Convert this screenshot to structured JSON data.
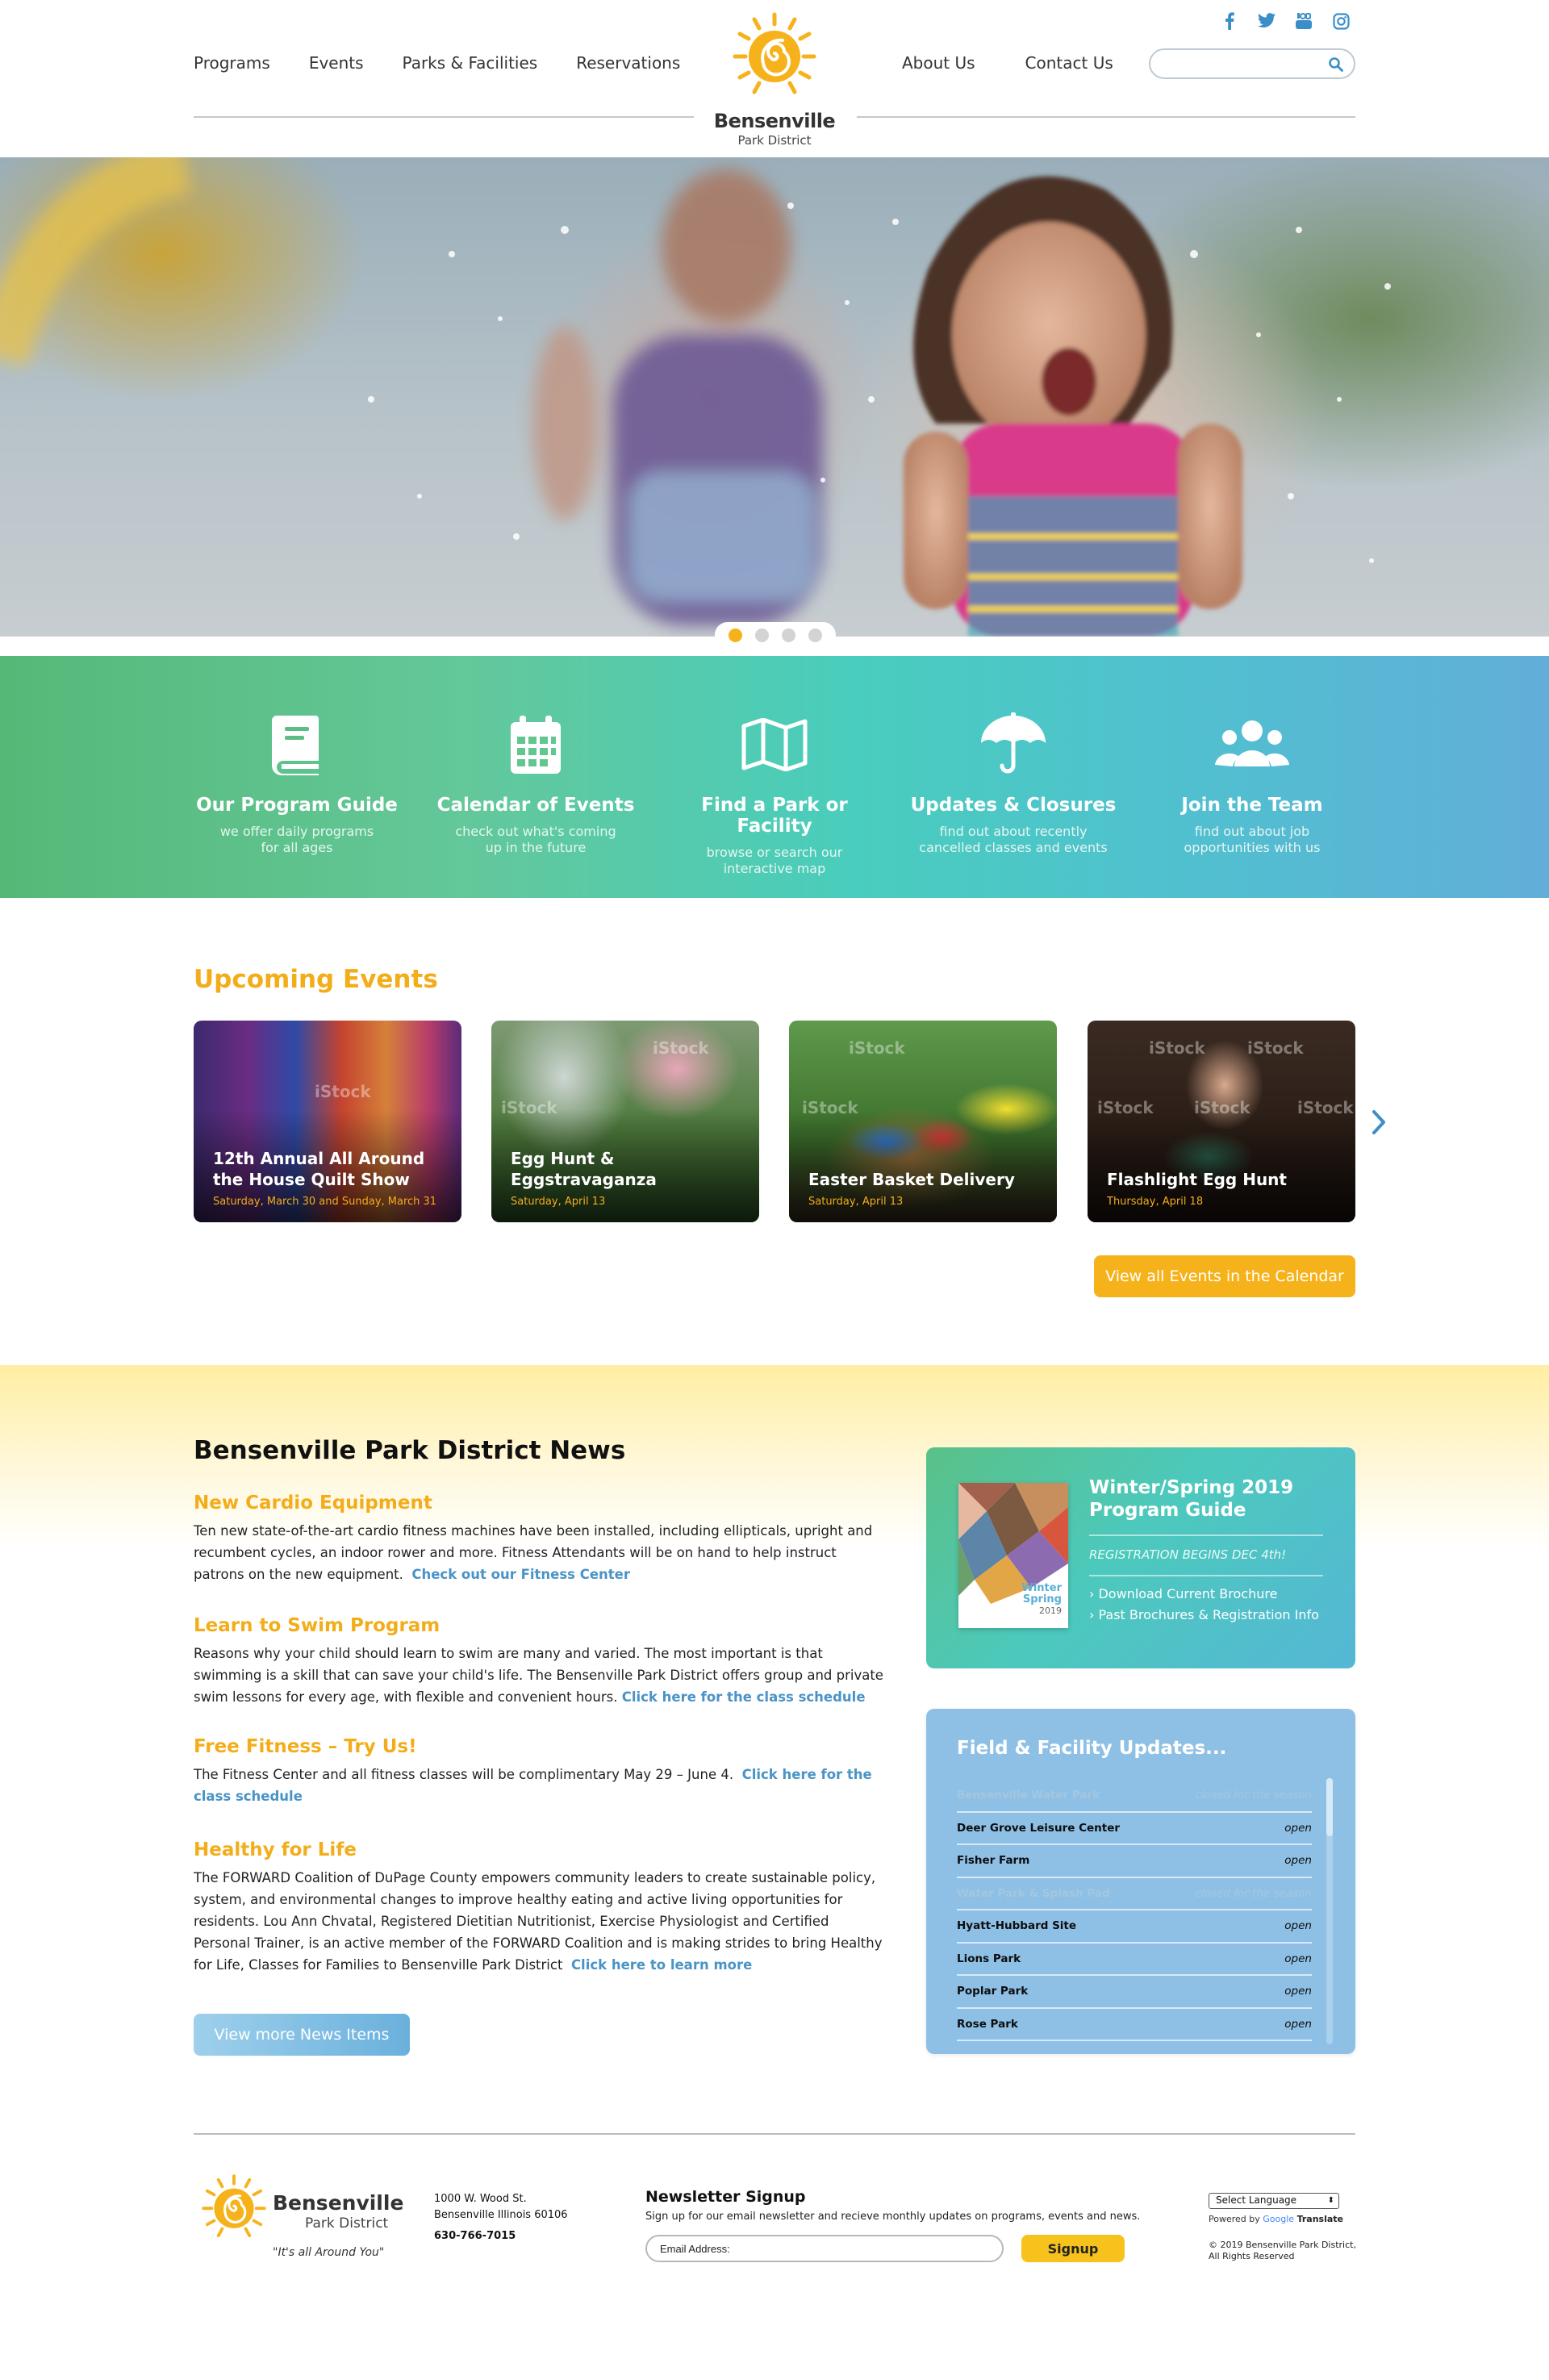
{
  "header": {
    "nav_left": [
      "Programs",
      "Events",
      "Parks & Facilities",
      "Reservations"
    ],
    "nav_right": [
      "About Us",
      "Contact Us"
    ],
    "logo": {
      "name": "Bensenville",
      "sub": "Park District"
    },
    "social": [
      "facebook-icon",
      "twitter-icon",
      "youtube-icon",
      "instagram-icon"
    ],
    "search": {
      "placeholder": "",
      "value": ""
    }
  },
  "hero": {
    "slides": 4,
    "active_slide": 1
  },
  "colors": {
    "accent_yellow": "#f6b21b",
    "link_blue": "#4a93c6",
    "band_start": "#56b877",
    "band_end": "#62aed8"
  },
  "quick_links": [
    {
      "icon": "book-icon",
      "title": "Our Program Guide",
      "desc1": "we offer daily programs",
      "desc2": "for all ages"
    },
    {
      "icon": "calendar-icon",
      "title": "Calendar of Events",
      "desc1": "check out what's coming",
      "desc2": "up in the future"
    },
    {
      "icon": "map-icon",
      "title": "Find a Park or Facility",
      "desc1": "browse or search our",
      "desc2": "interactive map"
    },
    {
      "icon": "umbrella-icon",
      "title": "Updates & Closures",
      "desc1": "find out about recently",
      "desc2": "cancelled classes and events"
    },
    {
      "icon": "people-icon",
      "title": "Join the Team",
      "desc1": "find out about job",
      "desc2": "opportunities with us"
    }
  ],
  "events": {
    "title": "Upcoming Events",
    "cards": [
      {
        "title": "12th Annual All Around the House Quilt Show",
        "date": "Saturday, March 30 and Sunday, March 31"
      },
      {
        "title": "Egg Hunt & Eggstravaganza",
        "date": "Saturday, April 13"
      },
      {
        "title": "Easter Basket Delivery",
        "date": "Saturday, April 13"
      },
      {
        "title": "Flashlight Egg Hunt",
        "date": "Thursday, April 18"
      }
    ],
    "watermark": "iStock",
    "calendar_button": "View all Events in the Calendar"
  },
  "news": {
    "title": "Bensenville Park District News",
    "items": [
      {
        "heading": "New Cardio Equipment",
        "body": "Ten new state-of-the-art cardio fitness machines have been installed, including ellipticals, upright and recumbent cycles, an indoor rower and more. Fitness Attendants will be on hand to help instruct patrons on the new equipment.",
        "link": "Check out our Fitness Center"
      },
      {
        "heading": "Learn to Swim Program",
        "body": "Reasons why your child should learn to swim are many and varied. The most important is that swimming is a skill that can save your child's life. The Bensenville Park District offers group and private swim lessons for every age, with flexible and convenient hours.",
        "link": "Click here for the class schedule"
      },
      {
        "heading": "Free Fitness – Try Us!",
        "body": "The Fitness Center and all fitness classes will be complimentary May 29 – June 4.",
        "link": "Click here for the class schedule"
      },
      {
        "heading": "Healthy for Life",
        "body": "The FORWARD Coalition of DuPage County empowers community leaders to create sustainable policy, system, and environmental changes to improve healthy eating and active living opportunities for residents. Lou Ann Chvatal, Registered Dietitian Nutritionist, Exercise Physiologist and Certified Personal Trainer, is an active member of the FORWARD Coalition and is making strides to bring Healthy for Life, Classes for Families to Bensenville Park District",
        "link": "Click here to learn more"
      }
    ],
    "more_button": "View more News Items"
  },
  "brochure": {
    "title": "Winter/Spring 2019 Program Guide",
    "registration": "REGISTRATION BEGINS DEC 4th!",
    "links": [
      "Download Current Brochure",
      "Past Brochures & Registration Info"
    ],
    "cover": {
      "season1": "Winter",
      "season2": "Spring",
      "year": "2019"
    }
  },
  "facilities": {
    "title": "Field & Facility Updates...",
    "rows": [
      {
        "name": "Bensenville Water Park",
        "status": "closed for the season",
        "closed": true
      },
      {
        "name": "Deer Grove Leisure Center",
        "status": "open",
        "closed": false
      },
      {
        "name": "Fisher Farm",
        "status": "open",
        "closed": false
      },
      {
        "name": "Water Park & Splash Pad",
        "status": "closed for the season",
        "closed": true
      },
      {
        "name": "Hyatt-Hubbard Site",
        "status": "open",
        "closed": false
      },
      {
        "name": "Lions Park",
        "status": "open",
        "closed": false
      },
      {
        "name": "Poplar Park",
        "status": "open",
        "closed": false
      },
      {
        "name": "Rose Park",
        "status": "open",
        "closed": false
      }
    ]
  },
  "footer": {
    "logo_name": "Bensenville",
    "logo_sub": "Park District",
    "tagline": "\"It's all Around You\"",
    "address1": "1000 W. Wood St.",
    "address2": "Bensenville Illinois 60106",
    "phone": "630-766-7015",
    "newsletter_title": "Newsletter Signup",
    "newsletter_desc": "Sign up for our email newsletter and recieve monthly updates on programs, events and news.",
    "email_placeholder": "Email Address:",
    "signup_button": "Signup",
    "language_select": "Select Language",
    "powered_by": "Powered by",
    "google": "Google",
    "translate": "Translate",
    "copyright1": "© 2019 Bensenville Park District,",
    "copyright2": "All Rights Reserved"
  }
}
